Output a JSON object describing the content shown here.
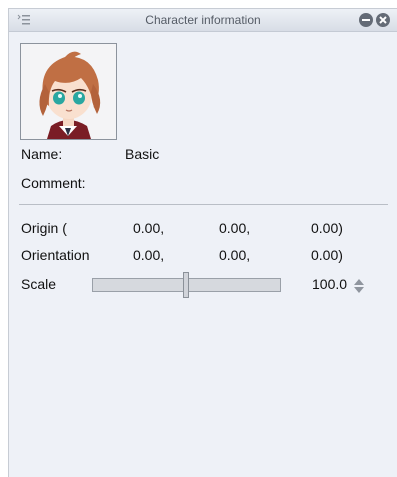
{
  "window": {
    "title": "Character information"
  },
  "character": {
    "name_label": "Name:",
    "name_value": "Basic",
    "comment_label": "Comment:"
  },
  "transform": {
    "origin": {
      "label": "Origin (",
      "x": "0.00,",
      "y": "0.00,",
      "z": "0.00)"
    },
    "orientation": {
      "label": "Orientation",
      "x": "0.00,",
      "y": "0.00,",
      "z": "0.00)"
    },
    "scale": {
      "label": "Scale",
      "value": "100.0",
      "slider_level_percent": 50
    }
  },
  "icons": {
    "menu": "menu-icon",
    "minimize": "minimize-icon",
    "close": "close-icon",
    "spinner": "spin-up-down-icon"
  }
}
